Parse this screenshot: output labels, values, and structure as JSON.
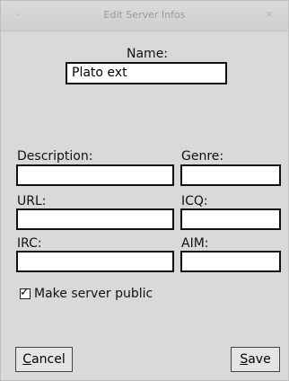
{
  "window": {
    "title": "Edit Server Infos",
    "minimize_glyph": "–",
    "close_glyph": "×"
  },
  "form": {
    "name_label": "Name:",
    "name_value": "Plato ext",
    "description_label": "Description:",
    "description_value": "",
    "genre_label": "Genre:",
    "genre_value": "",
    "url_label": "URL:",
    "url_value": "",
    "icq_label": "ICQ:",
    "icq_value": "",
    "irc_label": "IRC:",
    "irc_value": "",
    "aim_label": "AIM:",
    "aim_value": "",
    "public_checkbox_label": "Make server public",
    "public_checked": true
  },
  "buttons": {
    "cancel_mnemonic": "C",
    "cancel_rest": "ancel",
    "save_mnemonic": "S",
    "save_rest": "ave"
  },
  "icons": {
    "minimize": "minimize-icon",
    "close": "close-icon",
    "check": "checkmark-icon"
  }
}
